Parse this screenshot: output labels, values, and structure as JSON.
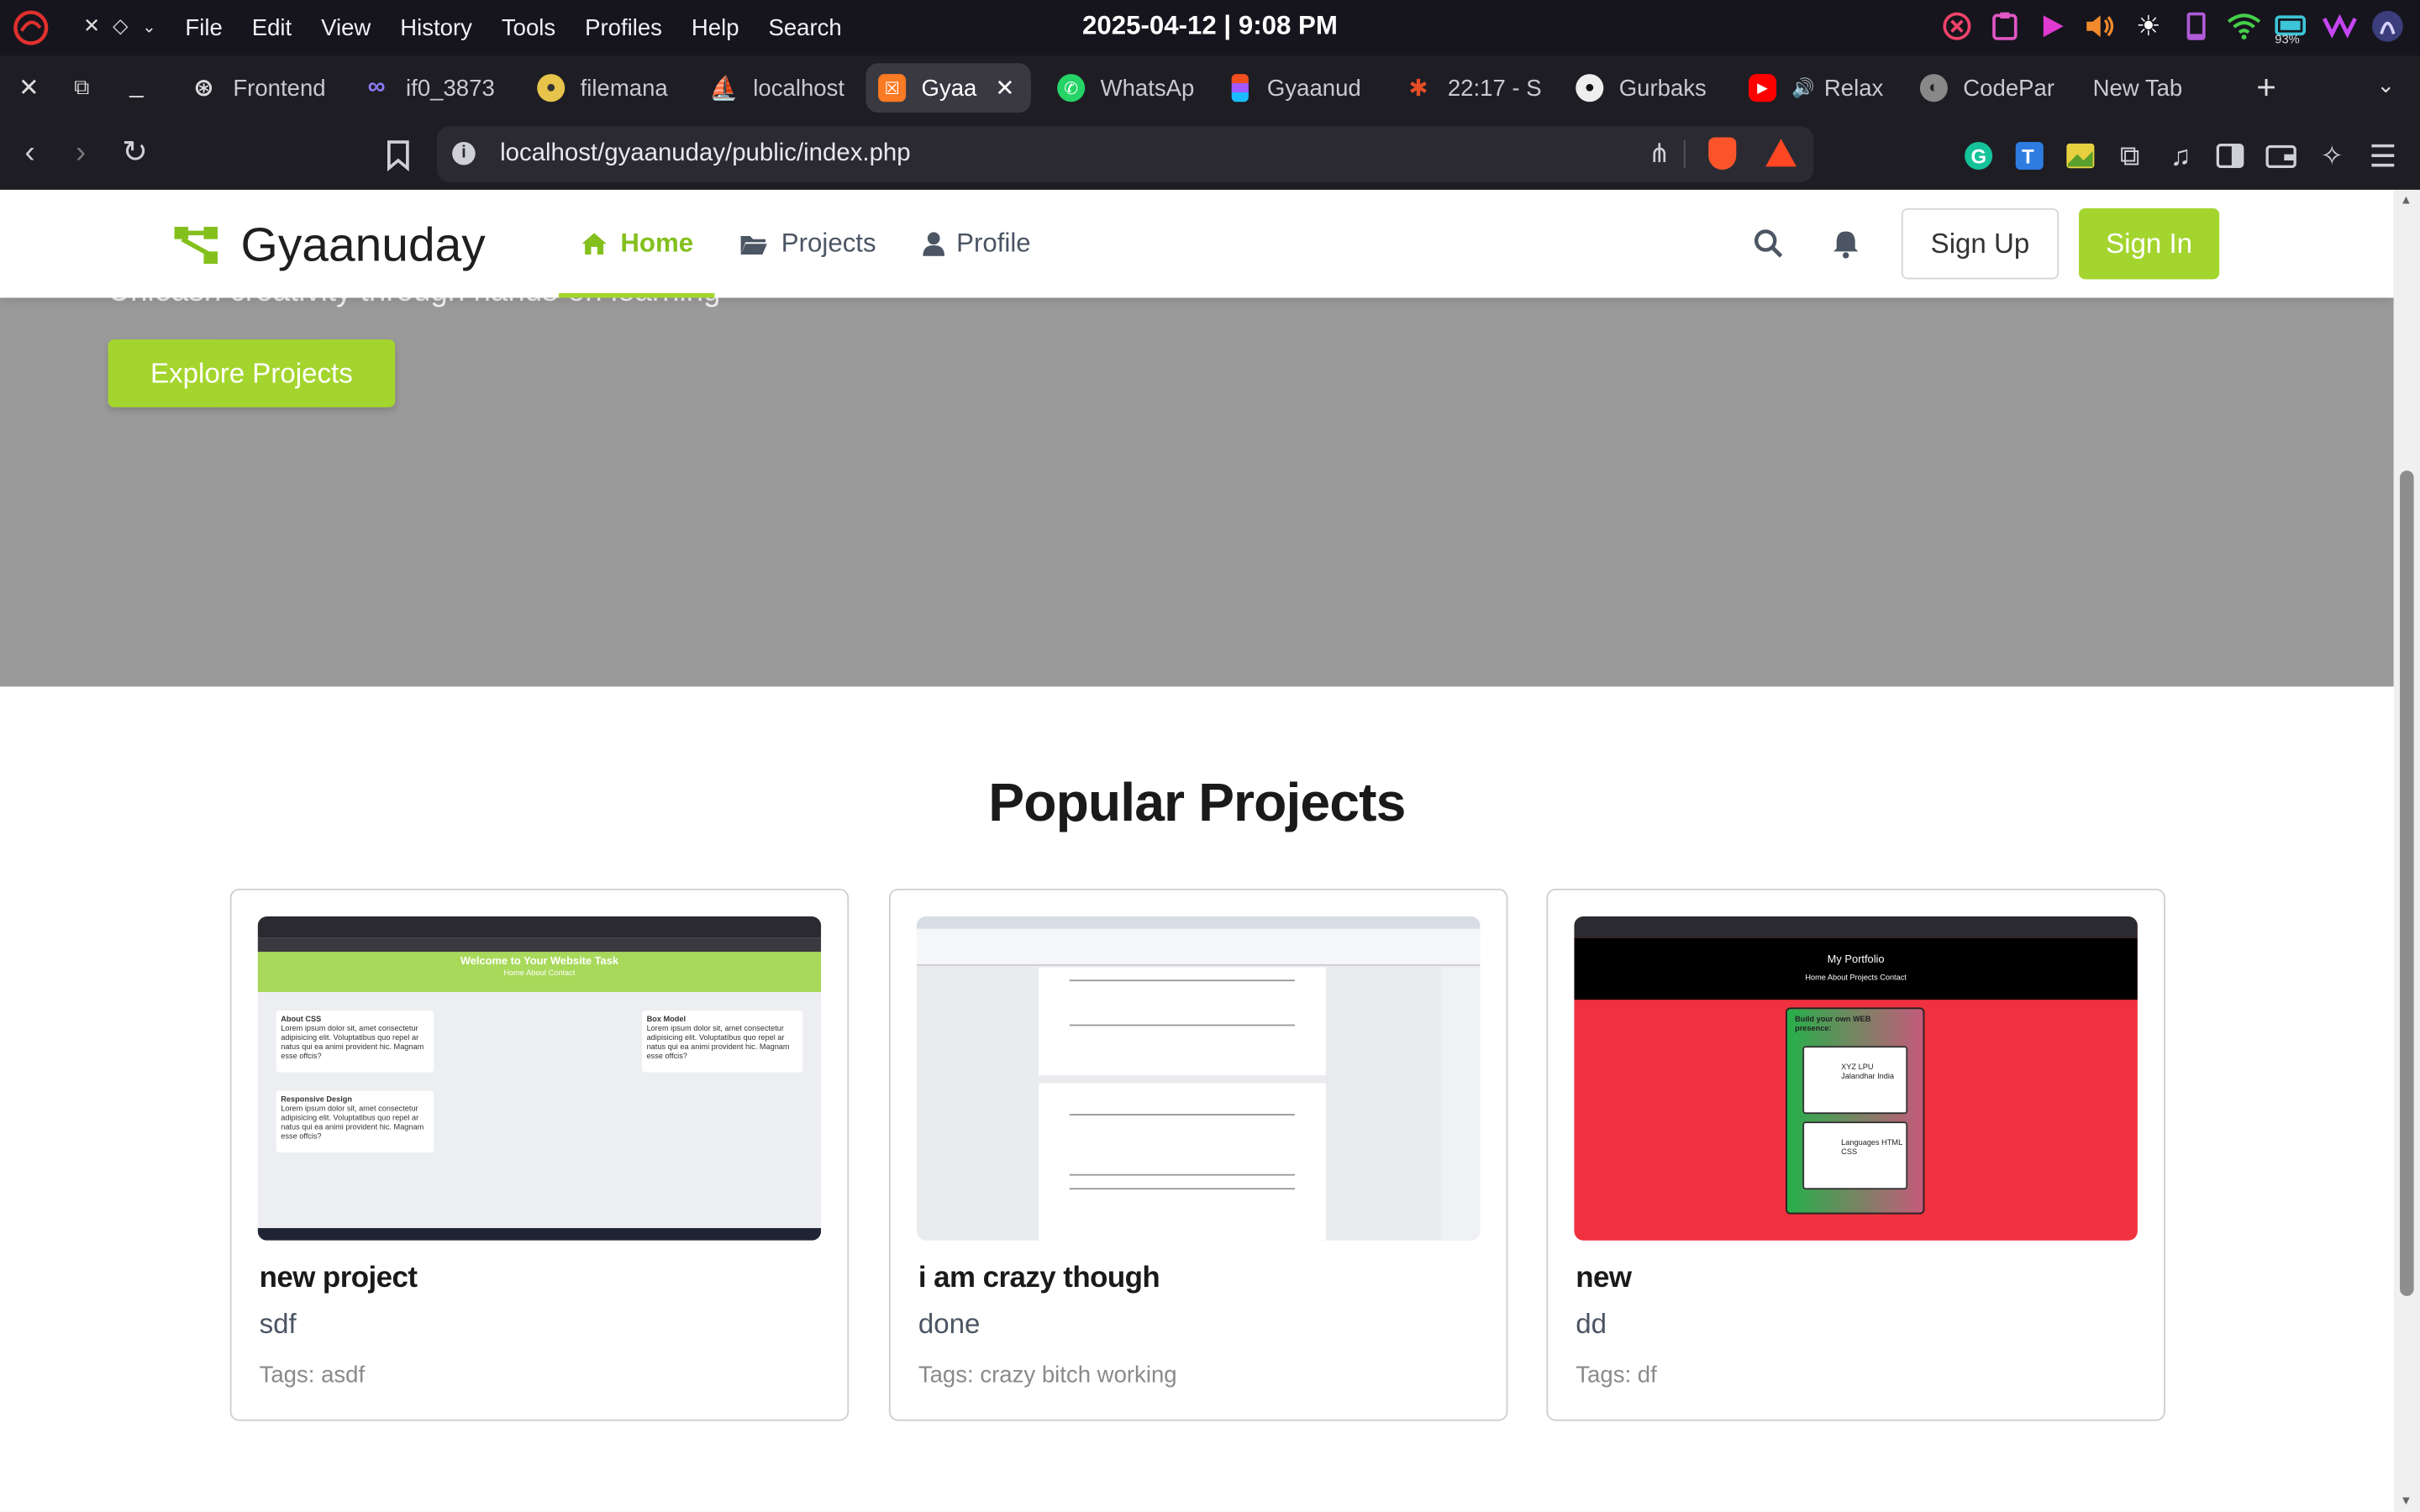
{
  "os": {
    "menu": [
      "File",
      "Edit",
      "View",
      "History",
      "Tools",
      "Profiles",
      "Help",
      "Search"
    ],
    "clock": "2025-04-12 | 9:08 PM",
    "battery": "93%"
  },
  "tabs": [
    {
      "label": "Frontend",
      "icon": "openai-icon",
      "color": "#2b2a33"
    },
    {
      "label": "if0_3873",
      "icon": "infinity-icon",
      "color": "#2b2a33"
    },
    {
      "label": "filemana",
      "icon": "filemanager-icon",
      "color": "#e6c34a"
    },
    {
      "label": "localhost",
      "icon": "phpmyadmin-icon",
      "color": "#f29111"
    },
    {
      "label": "Gyaa",
      "icon": "xampp-icon",
      "color": "#fb7a24",
      "active": true
    },
    {
      "label": "WhatsAp",
      "icon": "whatsapp-icon",
      "color": "#25d366"
    },
    {
      "label": "Gyaanud",
      "icon": "figma-icon",
      "color": "#a259ff"
    },
    {
      "label": "22:17 - S",
      "icon": "sheet-icon",
      "color": "#e44d26"
    },
    {
      "label": "Gurbaks",
      "icon": "github-icon",
      "color": "#2b2a33"
    },
    {
      "label": "Relax",
      "icon": "youtube-icon",
      "color": "#ff0000"
    },
    {
      "label": "CodePar",
      "icon": "codepen-icon",
      "color": "#2b2a33"
    },
    {
      "label": "New Tab",
      "icon": "",
      "color": ""
    }
  ],
  "address": {
    "url": "localhost/gyaanuday/public/index.php"
  },
  "site": {
    "brand": "Gyaanuday",
    "nav": [
      {
        "label": "Home",
        "icon": "home-icon",
        "active": true
      },
      {
        "label": "Projects",
        "icon": "folder-icon",
        "active": false
      },
      {
        "label": "Profile",
        "icon": "user-icon",
        "active": false
      }
    ],
    "signup_label": "Sign Up",
    "signin_label": "Sign In",
    "accent": "#a4d52e"
  },
  "hero": {
    "subtitle": "Unleash creativity through hands-on learning",
    "cta_label": "Explore Projects"
  },
  "popular": {
    "title": "Popular Projects",
    "cards": [
      {
        "title": "new project",
        "desc": "sdf",
        "tags": "Tags: asdf"
      },
      {
        "title": "i am crazy though",
        "desc": "done",
        "tags": "Tags: crazy bitch working"
      },
      {
        "title": "new",
        "desc": "dd",
        "tags": "Tags: df"
      }
    ]
  },
  "thumbs": {
    "one": {
      "heading": "Welcome to Your Website Task",
      "nav": "Home   About   Contact",
      "boxes": [
        {
          "title": "About CSS",
          "body": "Lorem ipsum dolor sit, amet consectetur adipisicing elit. Voluptatibus quo repel ar natus qui ea animi provident hic. Magnam esse offcis?"
        },
        {
          "title": "Box Model",
          "body": "Lorem ipsum dolor sit, amet consectetur adipisicing elit. Voluptatibus quo repel ar natus qui ea animi provident hic. Magnam esse offcis?"
        },
        {
          "title": "Responsive Design",
          "body": "Lorem ipsum dolor sit, amet consectetur adipisicing elit. Voluptatibus quo repel ar natus qui ea animi provident hic. Magnam esse offcis?"
        }
      ]
    },
    "three": {
      "heading": "My Portfolio",
      "nav": "Home   About   Projects   Contact",
      "panel_title": "Build your own WEB presence:",
      "item1": "XYZ LPU Jalandhar India",
      "item2": "Languages HTML CSS"
    }
  }
}
